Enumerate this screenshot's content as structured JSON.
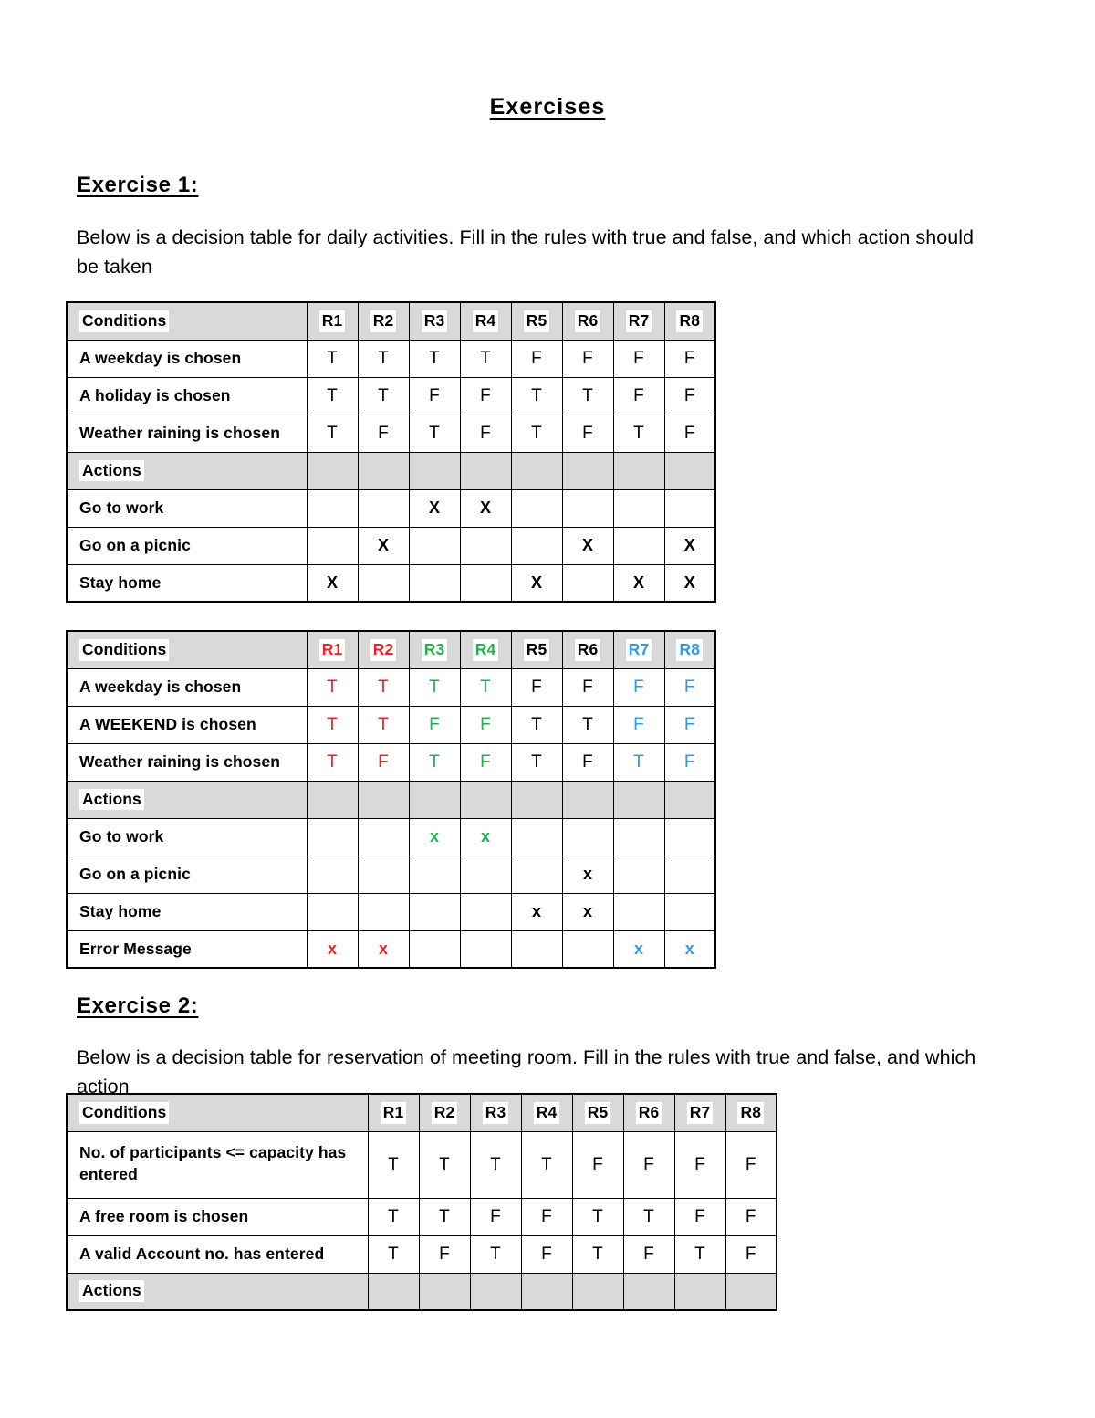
{
  "document": {
    "title": "Exercises"
  },
  "exercise1": {
    "heading": "Exercise 1:",
    "intro": "Below is a decision table for daily activities. Fill in the rules with true and false, and which action should be taken",
    "table1": {
      "conditions_label": "Conditions",
      "actions_label": "Actions",
      "rules": [
        "R1",
        "R2",
        "R3",
        "R4",
        "R5",
        "R6",
        "R7",
        "R8"
      ],
      "conditions": [
        {
          "label": "A weekday is chosen",
          "values": [
            "T",
            "T",
            "T",
            "T",
            "F",
            "F",
            "F",
            "F"
          ]
        },
        {
          "label": "A holiday is chosen",
          "values": [
            "T",
            "T",
            "F",
            "F",
            "T",
            "T",
            "F",
            "F"
          ]
        },
        {
          "label": "Weather raining is chosen",
          "values": [
            "T",
            "F",
            "T",
            "F",
            "T",
            "F",
            "T",
            "F"
          ]
        }
      ],
      "actions": [
        {
          "label": "Go to work",
          "values": [
            "",
            "",
            "X",
            "X",
            "",
            "",
            "",
            ""
          ]
        },
        {
          "label": "Go on a picnic",
          "values": [
            "",
            "X",
            "",
            "",
            "",
            "X",
            "",
            "X"
          ]
        },
        {
          "label": "Stay home",
          "values": [
            "X",
            "",
            "",
            "",
            "X",
            "",
            "X",
            "X"
          ]
        }
      ]
    },
    "table2": {
      "conditions_label": "Conditions",
      "actions_label": "Actions",
      "rules": [
        "R1",
        "R2",
        "R3",
        "R4",
        "R5",
        "R6",
        "R7",
        "R8"
      ],
      "rule_colors": [
        "red",
        "red",
        "green",
        "green",
        "black",
        "black",
        "blue",
        "blue"
      ],
      "conditions": [
        {
          "label": "A weekday is chosen",
          "values": [
            "T",
            "T",
            "T",
            "T",
            "F",
            "F",
            "F",
            "F"
          ],
          "colors": [
            "red",
            "red",
            "green",
            "green",
            "black",
            "black",
            "blue",
            "blue"
          ]
        },
        {
          "label": "A WEEKEND is chosen",
          "values": [
            "T",
            "T",
            "F",
            "F",
            "T",
            "T",
            "F",
            "F"
          ],
          "colors": [
            "red",
            "red",
            "green",
            "green",
            "black",
            "black",
            "blue",
            "blue"
          ]
        },
        {
          "label": "Weather raining is chosen",
          "values": [
            "T",
            "F",
            "T",
            "F",
            "T",
            "F",
            "T",
            "F"
          ],
          "colors": [
            "red",
            "red",
            "green",
            "green",
            "black",
            "black",
            "blue",
            "blue"
          ]
        }
      ],
      "actions": [
        {
          "label": "Go to work",
          "values": [
            "",
            "",
            "x",
            "x",
            "",
            "",
            "",
            ""
          ],
          "colors": [
            "black",
            "black",
            "green",
            "green",
            "black",
            "black",
            "black",
            "black"
          ]
        },
        {
          "label": "Go on a picnic",
          "values": [
            "",
            "",
            "",
            "",
            "",
            "x",
            "",
            ""
          ],
          "colors": [
            "black",
            "black",
            "black",
            "black",
            "black",
            "black",
            "black",
            "black"
          ]
        },
        {
          "label": "Stay home",
          "values": [
            "",
            "",
            "",
            "",
            "x",
            "x",
            "",
            ""
          ],
          "colors": [
            "black",
            "black",
            "black",
            "black",
            "black",
            "black",
            "black",
            "black"
          ]
        },
        {
          "label": "Error Message",
          "values": [
            "x",
            "x",
            "",
            "",
            "",
            "",
            "x",
            "x"
          ],
          "colors": [
            "red",
            "red",
            "black",
            "black",
            "black",
            "black",
            "blue",
            "blue"
          ]
        }
      ]
    }
  },
  "exercise2": {
    "heading": "Exercise 2:",
    "intro": "Below is a decision table for reservation of meeting room. Fill in the rules with true and false, and which action",
    "table": {
      "conditions_label": "Conditions",
      "actions_label": "Actions",
      "rules": [
        "R1",
        "R2",
        "R3",
        "R4",
        "R5",
        "R6",
        "R7",
        "R8"
      ],
      "conditions": [
        {
          "label": "No. of participants <= capacity has entered",
          "values": [
            "T",
            "T",
            "T",
            "T",
            "F",
            "F",
            "F",
            "F"
          ]
        },
        {
          "label": "A free room is chosen",
          "values": [
            "T",
            "T",
            "F",
            "F",
            "T",
            "T",
            "F",
            "F"
          ]
        },
        {
          "label": "A valid Account no. has entered",
          "values": [
            "T",
            "F",
            "T",
            "F",
            "T",
            "F",
            "T",
            "F"
          ]
        }
      ],
      "actions": []
    }
  },
  "colors": {
    "red": "#ee2222",
    "green": "#22b14c",
    "blue": "#2e9be0",
    "black": "#000000",
    "header_gray": "#d9d9d9"
  }
}
